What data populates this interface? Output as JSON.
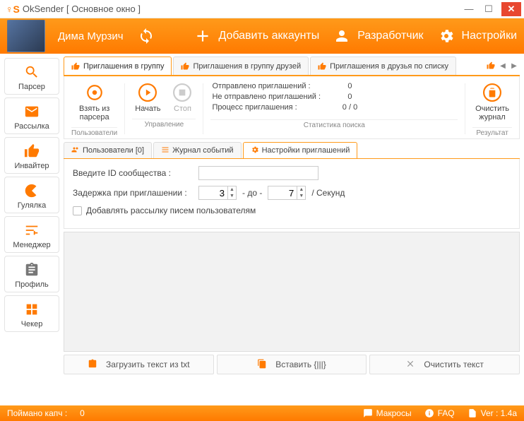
{
  "window": {
    "logo": "♀S",
    "title": "OkSender [ Основное окно ]"
  },
  "header": {
    "username": "Дима Мурзич",
    "add_accounts": "Добавить аккаунты",
    "developer": "Разработчик",
    "settings": "Настройки"
  },
  "sidebar": {
    "items": [
      "Парсер",
      "Рассылка",
      "Инвайтер",
      "Гулялка",
      "Менеджер",
      "Профиль",
      "Чекер"
    ]
  },
  "main_tabs": {
    "t0": "Приглашения в группу",
    "t1": "Приглашения в группу друзей",
    "t2": "Приглашения в друзья по списку"
  },
  "toolbar": {
    "take_parser": "Взять из\nпарсера",
    "start": "Начать",
    "stop": "Стоп",
    "clear_log": "Очистить\nжурнал",
    "group_users": "Пользователи",
    "group_control": "Управление",
    "group_stats": "Статистика поиска",
    "group_result": "Результат",
    "stats": {
      "sent_label": "Отправлено приглашений :",
      "sent_val": "0",
      "notsent_label": "Не отправлено приглашений :",
      "notsent_val": "0",
      "process_label": "Процесс приглашения :",
      "process_val": "0 / 0"
    }
  },
  "sub_tabs": {
    "users": "Пользователи [0]",
    "log": "Журнал событий",
    "settings": "Настройки приглашений"
  },
  "form": {
    "community_label": "Введите ID сообщества :",
    "delay_label": "Задержка при приглашении :",
    "delay_from": "3",
    "delay_sep": "- до -",
    "delay_to": "7",
    "delay_unit": "/ Секунд",
    "checkbox_label": "Добавлять рассылку писем пользователям"
  },
  "bottom": {
    "load_txt": "Загрузить текст из txt",
    "paste": "Вставить {|||}",
    "clear": "Очистить текст"
  },
  "status": {
    "captcha_label": "Поймано капч :",
    "captcha_val": "0",
    "macros": "Макросы",
    "faq": "FAQ",
    "ver": "Ver : 1.4a"
  }
}
